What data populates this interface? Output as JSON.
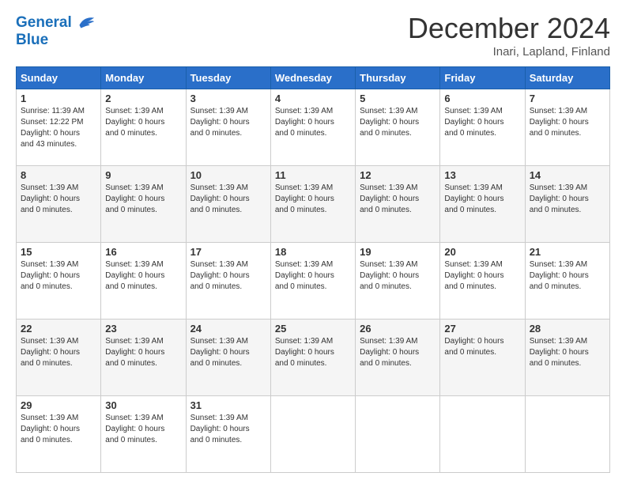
{
  "header": {
    "logo_line1": "General",
    "logo_line2": "Blue",
    "title": "December 2024",
    "subtitle": "Inari, Lapland, Finland"
  },
  "days_of_week": [
    "Sunday",
    "Monday",
    "Tuesday",
    "Wednesday",
    "Thursday",
    "Friday",
    "Saturday"
  ],
  "weeks": [
    [
      {
        "day": "1",
        "lines": [
          "Sunrise: 11:39 AM",
          "Sunset: 12:22 PM",
          "Daylight: 0 hours",
          "and 43 minutes."
        ]
      },
      {
        "day": "2",
        "lines": [
          "Sunset: 1:39 AM",
          "Daylight: 0 hours",
          "and 0 minutes."
        ]
      },
      {
        "day": "3",
        "lines": [
          "Sunset: 1:39 AM",
          "Daylight: 0 hours",
          "and 0 minutes."
        ]
      },
      {
        "day": "4",
        "lines": [
          "Sunset: 1:39 AM",
          "Daylight: 0 hours",
          "and 0 minutes."
        ]
      },
      {
        "day": "5",
        "lines": [
          "Sunset: 1:39 AM",
          "Daylight: 0 hours",
          "and 0 minutes."
        ]
      },
      {
        "day": "6",
        "lines": [
          "Sunset: 1:39 AM",
          "Daylight: 0 hours",
          "and 0 minutes."
        ]
      },
      {
        "day": "7",
        "lines": [
          "Sunset: 1:39 AM",
          "Daylight: 0 hours",
          "and 0 minutes."
        ]
      }
    ],
    [
      {
        "day": "8",
        "lines": [
          "Sunset: 1:39 AM",
          "Daylight: 0 hours",
          "and 0 minutes."
        ]
      },
      {
        "day": "9",
        "lines": [
          "Sunset: 1:39 AM",
          "Daylight: 0 hours",
          "and 0 minutes."
        ]
      },
      {
        "day": "10",
        "lines": [
          "Sunset: 1:39 AM",
          "Daylight: 0 hours",
          "and 0 minutes."
        ]
      },
      {
        "day": "11",
        "lines": [
          "Sunset: 1:39 AM",
          "Daylight: 0 hours",
          "and 0 minutes."
        ]
      },
      {
        "day": "12",
        "lines": [
          "Sunset: 1:39 AM",
          "Daylight: 0 hours",
          "and 0 minutes."
        ]
      },
      {
        "day": "13",
        "lines": [
          "Sunset: 1:39 AM",
          "Daylight: 0 hours",
          "and 0 minutes."
        ]
      },
      {
        "day": "14",
        "lines": [
          "Sunset: 1:39 AM",
          "Daylight: 0 hours",
          "and 0 minutes."
        ]
      }
    ],
    [
      {
        "day": "15",
        "lines": [
          "Sunset: 1:39 AM",
          "Daylight: 0 hours",
          "and 0 minutes."
        ]
      },
      {
        "day": "16",
        "lines": [
          "Sunset: 1:39 AM",
          "Daylight: 0 hours",
          "and 0 minutes."
        ]
      },
      {
        "day": "17",
        "lines": [
          "Sunset: 1:39 AM",
          "Daylight: 0 hours",
          "and 0 minutes."
        ]
      },
      {
        "day": "18",
        "lines": [
          "Sunset: 1:39 AM",
          "Daylight: 0 hours",
          "and 0 minutes."
        ]
      },
      {
        "day": "19",
        "lines": [
          "Sunset: 1:39 AM",
          "Daylight: 0 hours",
          "and 0 minutes."
        ]
      },
      {
        "day": "20",
        "lines": [
          "Sunset: 1:39 AM",
          "Daylight: 0 hours",
          "and 0 minutes."
        ]
      },
      {
        "day": "21",
        "lines": [
          "Sunset: 1:39 AM",
          "Daylight: 0 hours",
          "and 0 minutes."
        ]
      }
    ],
    [
      {
        "day": "22",
        "lines": [
          "Sunset: 1:39 AM",
          "Daylight: 0 hours",
          "and 0 minutes."
        ]
      },
      {
        "day": "23",
        "lines": [
          "Sunset: 1:39 AM",
          "Daylight: 0 hours",
          "and 0 minutes."
        ]
      },
      {
        "day": "24",
        "lines": [
          "Sunset: 1:39 AM",
          "Daylight: 0 hours",
          "and 0 minutes."
        ]
      },
      {
        "day": "25",
        "lines": [
          "Sunset: 1:39 AM",
          "Daylight: 0 hours",
          "and 0 minutes."
        ]
      },
      {
        "day": "26",
        "lines": [
          "Sunset: 1:39 AM",
          "Daylight: 0 hours",
          "and 0 minutes."
        ]
      },
      {
        "day": "27",
        "lines": [
          "Daylight: 0 hours",
          "and 0 minutes."
        ]
      },
      {
        "day": "28",
        "lines": [
          "Sunset: 1:39 AM",
          "Daylight: 0 hours",
          "and 0 minutes."
        ]
      }
    ],
    [
      {
        "day": "29",
        "lines": [
          "Sunset: 1:39 AM",
          "Daylight: 0 hours",
          "and 0 minutes."
        ]
      },
      {
        "day": "30",
        "lines": [
          "Sunset: 1:39 AM",
          "Daylight: 0 hours",
          "and 0 minutes."
        ]
      },
      {
        "day": "31",
        "lines": [
          "Sunset: 1:39 AM",
          "Daylight: 0 hours",
          "and 0 minutes."
        ]
      },
      {
        "day": "",
        "lines": []
      },
      {
        "day": "",
        "lines": []
      },
      {
        "day": "",
        "lines": []
      },
      {
        "day": "",
        "lines": []
      }
    ]
  ]
}
